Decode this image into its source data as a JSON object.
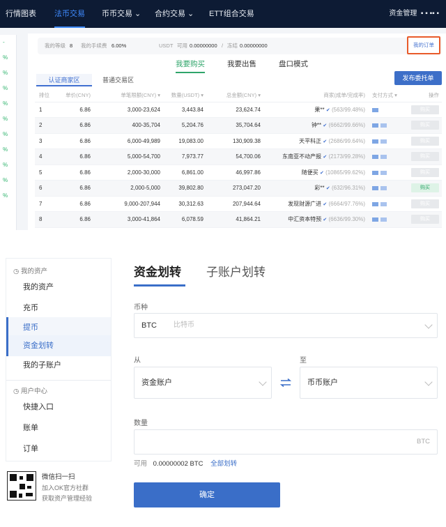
{
  "nav": {
    "items": [
      "行情图表",
      "法币交易",
      "币币交易",
      "合约交易",
      "ETT组合交易"
    ],
    "active_index": 1,
    "right_label": "资金管理"
  },
  "side_strip": [
    "-",
    "%",
    "%",
    "%",
    "%",
    "%",
    "%",
    "%",
    "%",
    "%",
    "%"
  ],
  "infobar": {
    "fee1_label": "我的等级",
    "fee1_value": "8",
    "fee2_label": "我的手续费",
    "fee2_value": "6.00%",
    "currency": "USDT",
    "avail_label": "可用",
    "avail_value": "0.00000000",
    "frozen_label": "冻结",
    "frozen_value": "0.00000000",
    "my_ad_label": "我的订单"
  },
  "trade_tabs": [
    "我要购买",
    "我要出售",
    "盘口模式"
  ],
  "sub_tabs": [
    "认证商家区",
    "普通交易区"
  ],
  "publish_label": "发布委托单",
  "table": {
    "headers": [
      "排位",
      "单价(CNY)",
      "单笔限额(CNY) ▾",
      "数量(USDT) ▾",
      "总金额(CNY) ▾",
      "商家(成单/完成率)",
      "支付方式 ▾",
      "操作"
    ],
    "rows": [
      {
        "rank": "1",
        "price": "6.86",
        "limit": "3,000-23,624",
        "qty": "3,443.84",
        "total": "23,624.74",
        "merchant": "果**",
        "stat": "(563/99.48%)",
        "op": "购买",
        "buy": false
      },
      {
        "rank": "2",
        "price": "6.86",
        "limit": "400-35,704",
        "qty": "5,204.76",
        "total": "35,704.64",
        "merchant": "钟**",
        "stat": "(6662/99.66%)",
        "op": "购买",
        "buy": false
      },
      {
        "rank": "3",
        "price": "6.86",
        "limit": "6,000-49,989",
        "qty": "19,083.00",
        "total": "130,909.38",
        "merchant": "天平科正",
        "stat": "(2686/99.64%)",
        "op": "购买",
        "buy": false
      },
      {
        "rank": "4",
        "price": "6.86",
        "limit": "5,000-54,700",
        "qty": "7,973.77",
        "total": "54,700.06",
        "merchant": "东南亚不动产报",
        "stat": "(2173/99.28%)",
        "op": "购买",
        "buy": false
      },
      {
        "rank": "5",
        "price": "6.86",
        "limit": "2,000-30,000",
        "qty": "6,861.00",
        "total": "46,997.86",
        "merchant": "随便买",
        "stat": "(10865/99.62%)",
        "op": "购买",
        "buy": false
      },
      {
        "rank": "6",
        "price": "6.86",
        "limit": "2,000-5,000",
        "qty": "39,802.80",
        "total": "273,047.20",
        "merchant": "彩**",
        "stat": "(632/96.31%)",
        "op": "购买",
        "buy": true
      },
      {
        "rank": "7",
        "price": "6.86",
        "limit": "9,000-207,944",
        "qty": "30,312.63",
        "total": "207,944.64",
        "merchant": "发现财源广进",
        "stat": "(6664/97.76%)",
        "op": "购买",
        "buy": false
      },
      {
        "rank": "8",
        "price": "6.86",
        "limit": "3,000-41,864",
        "qty": "6,078.59",
        "total": "41,864.21",
        "merchant": "中汇资本特预",
        "stat": "(6636/99.30%)",
        "op": "购买",
        "buy": false
      }
    ]
  },
  "sidebar": {
    "section1": "我的资产",
    "items1": [
      "我的资产",
      "充币",
      "提币",
      "资金划转",
      "我的子账户"
    ],
    "section2": "用户中心",
    "items2": [
      "快捷入口",
      "账单",
      "订单"
    ]
  },
  "qr": {
    "title": "微信扫一扫",
    "line1": "加入OK官方社群",
    "line2": "获取资产管理经验"
  },
  "transfer": {
    "tab_active": "资金划转",
    "tab_other": "子账户划转",
    "coin_label": "币种",
    "coin_value": "BTC",
    "coin_sub": "比特币",
    "from_label": "从",
    "from_value": "资金账户",
    "to_label": "至",
    "to_value": "币币账户",
    "amount_label": "数量",
    "amount_unit": "BTC",
    "avail_label": "可用",
    "avail_value": "0.00000002 BTC",
    "all_link": "全部划转",
    "confirm": "确定"
  },
  "colors": {
    "nav_bg": "#0d1b34",
    "accent": "#3a6ec8",
    "buy_green": "#2fa56a",
    "highlight_border": "#e85a2a"
  }
}
